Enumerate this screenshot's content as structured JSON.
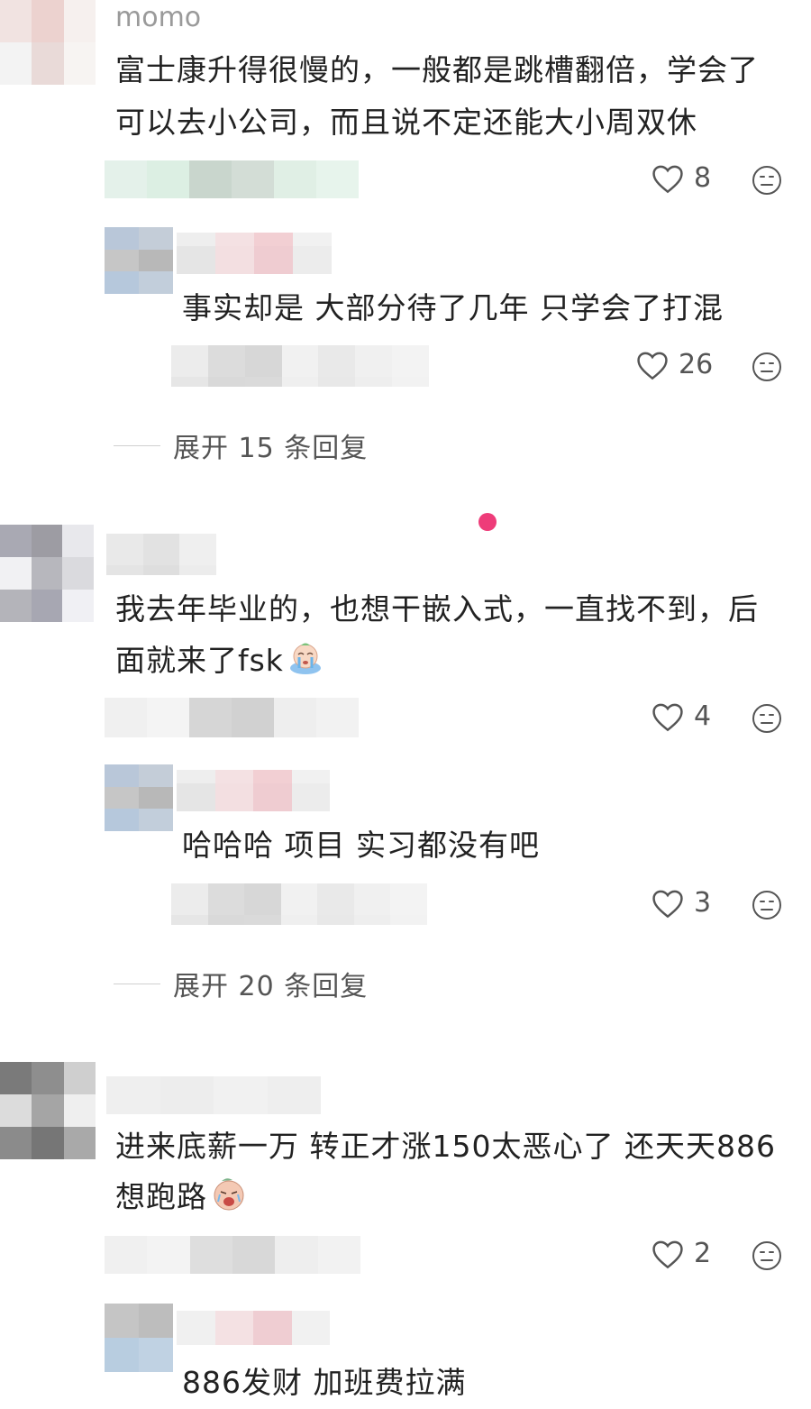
{
  "comments": [
    {
      "username": "momo",
      "text_lines": [
        "富士康升得很慢的，一般都是跳槽翻倍，学会了",
        "可以去小公司，而且说不定还能大小周双休"
      ],
      "likes": "8",
      "reply": {
        "text": "事实却是 大部分待了几年 只学会了打混",
        "likes": "26"
      },
      "expand_label": "展开 15 条回复"
    },
    {
      "text_lines": [
        "我去年毕业的，也想干嵌入式，一直找不到，后",
        "面就来了fsk"
      ],
      "likes": "4",
      "reply": {
        "text": "哈哈哈 项目 实习都没有吧",
        "likes": "3"
      },
      "expand_label": "展开 20 条回复"
    },
    {
      "text_lines": [
        "进来底薪一万 转正才涨150太恶心了 还天天886",
        "想跑路"
      ],
      "likes": "2",
      "reply": {
        "text": "886发财 加班费拉满"
      }
    }
  ],
  "icons": {
    "like": "heart-outline-icon",
    "dislike": "neutral-face-icon",
    "sticker_1": "crying-sticker",
    "sticker_2": "crying-sticker"
  },
  "colors": {
    "text": "#222222",
    "meta": "#555555",
    "accent_dot": "#ee3c79"
  }
}
